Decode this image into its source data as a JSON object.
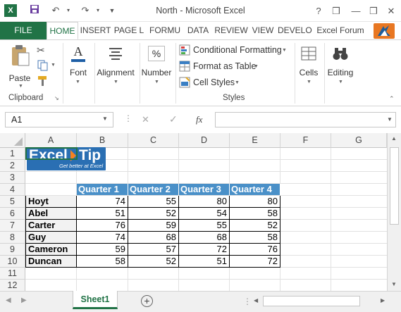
{
  "window": {
    "title": "North - Microsoft Excel",
    "controls": [
      "?",
      "❒",
      "—",
      "❒",
      "✕"
    ]
  },
  "tabs": {
    "file": "FILE",
    "items": [
      "HOME",
      "INSERT",
      "PAGE L",
      "FORMU",
      "DATA",
      "REVIEW",
      "VIEW",
      "DEVELO",
      "Excel Forum"
    ],
    "active": "HOME"
  },
  "ribbon": {
    "clipboard": {
      "paste": "Paste",
      "group": "Clipboard"
    },
    "font": {
      "label": "Font",
      "icon_letter": "A"
    },
    "alignment": {
      "label": "Alignment"
    },
    "number": {
      "label": "Number",
      "icon_symbol": "%"
    },
    "styles": {
      "conditional": "Conditional Formatting",
      "format_table": "Format as Table",
      "cell_styles": "Cell Styles",
      "group": "Styles"
    },
    "cells": {
      "label": "Cells"
    },
    "editing": {
      "label": "Editing"
    }
  },
  "formula_bar": {
    "name_box": "A1",
    "cancel_symbol": "✕",
    "enter_symbol": "✓",
    "fx": "fx",
    "formula": ""
  },
  "grid": {
    "columns": [
      "A",
      "B",
      "C",
      "D",
      "E",
      "F",
      "G"
    ],
    "rows": [
      "1",
      "2",
      "3",
      "4",
      "5",
      "6",
      "7",
      "8",
      "9",
      "10",
      "11",
      "12"
    ],
    "logo": {
      "excel": "Excel",
      "tip": "Tip",
      "tagline": "Get better at Excel"
    },
    "headers": [
      "Quarter 1",
      "Quarter 2",
      "Quarter 3",
      "Quarter 4"
    ],
    "data": [
      {
        "name": "Hoyt",
        "values": [
          "74",
          "55",
          "80",
          "80"
        ]
      },
      {
        "name": "Abel",
        "values": [
          "51",
          "52",
          "54",
          "58"
        ]
      },
      {
        "name": "Carter",
        "values": [
          "76",
          "59",
          "55",
          "52"
        ]
      },
      {
        "name": "Guy",
        "values": [
          "74",
          "68",
          "68",
          "58"
        ]
      },
      {
        "name": "Cameron",
        "values": [
          "59",
          "57",
          "72",
          "76"
        ]
      },
      {
        "name": "Duncan",
        "values": [
          "58",
          "52",
          "51",
          "72"
        ]
      }
    ]
  },
  "sheets": {
    "active": "Sheet1",
    "add_symbol": "+"
  },
  "colors": {
    "excel_green": "#217346",
    "header_blue": "#4a90c8"
  }
}
